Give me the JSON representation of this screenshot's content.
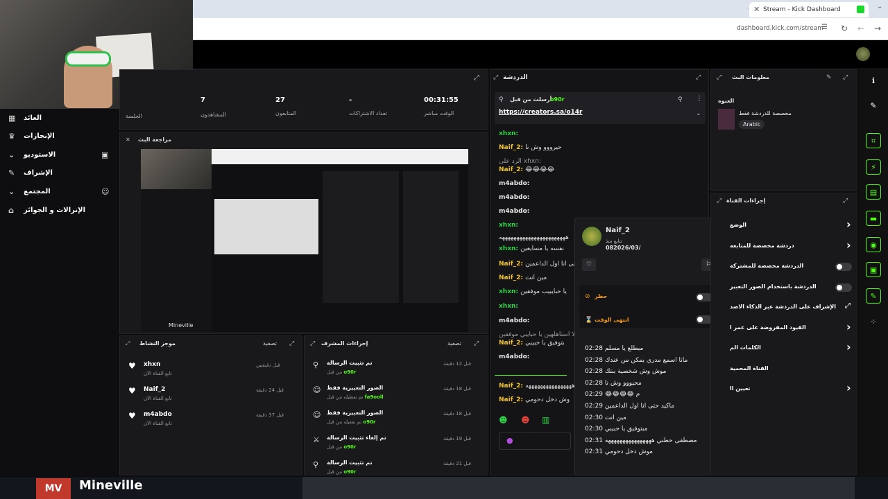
{
  "browser": {
    "tab_title": "Stream - Kick Dashboard",
    "tab_close": "✕",
    "new_tab": "+",
    "url": "dashboard.kick.com/stream"
  },
  "stats": [
    {
      "value": "00:31:55",
      "label": "الوقت مباشر"
    },
    {
      "value": "-",
      "label": "تعداد الاشتراكات"
    },
    {
      "value": "27",
      "label": "المتابعون"
    },
    {
      "value": "7",
      "label": "المشاهدون"
    },
    {
      "value": "",
      "label": "الجلسة"
    }
  ],
  "sidebar": [
    {
      "label": "العائد",
      "icon": "chart-icon"
    },
    {
      "label": "الإنجازات",
      "icon": "trophy-icon"
    },
    {
      "label": "الاستوديو",
      "icon": "chevron-down-icon"
    },
    {
      "label": "الإشراف",
      "icon": "wrench-icon"
    },
    {
      "label": "المجتمع",
      "icon": "chevron-down-icon"
    },
    {
      "label": "الإنزالات و الجوائز",
      "icon": "gift-icon"
    }
  ],
  "preview": {
    "title": "مراجعة البث",
    "caption": "Mineville"
  },
  "activity": {
    "title": "موجز النشاط",
    "filter": "تصفية",
    "items": [
      {
        "name": "xhxn",
        "sub": "تابع القناة الآن",
        "time": "قبل دقيقتين"
      },
      {
        "name": "Naif_2",
        "sub": "تابع القناة الآن",
        "time": "قبل 24 دقيقة"
      },
      {
        "name": "m4abdo",
        "sub": "تابع القناة الآن",
        "time": "قبل 37 دقيقة"
      }
    ]
  },
  "modactions": {
    "title": "إجراءات المشرف",
    "filter": "تصفية",
    "items": [
      {
        "action": "تم تثبيت الرسالة",
        "by": "o90r",
        "by_prefix": "من قبل",
        "time": "قبل 12 دقيقة"
      },
      {
        "action": "الصور التعبيرية فقط",
        "by": "fa9ooll",
        "by_prefix": "تم تعطيله من قبل",
        "time": "قبل 18 دقيقة"
      },
      {
        "action": "الصور التعبيرية فقط",
        "by": "o90r",
        "by_prefix": "تم تفعيله من قبل",
        "time": "قبل 18 دقيقة"
      },
      {
        "action": "تم إلغاء تثبيت الرسالة",
        "by": "o90r",
        "by_prefix": "من قبل",
        "time": "قبل 19 دقيقة"
      },
      {
        "action": "تم تثبيت الرسالة",
        "by": "o90r",
        "by_prefix": "من قبل",
        "time": "قبل 21 دقيقة"
      }
    ]
  },
  "chat": {
    "title": "الدردشة",
    "pinned_label": "أرسلت من قبل",
    "pinned_by": "o90r",
    "pinned_link": "https://creators.sa/o14r",
    "messages": [
      {
        "user": "xhxn",
        "text": "",
        "color": "#2fd34a"
      },
      {
        "user": "Naif_2",
        "text": "حيرووو وش نا",
        "color": "#f1c232"
      },
      {
        "user": "",
        "text": "الرد على xhxn:",
        "color": "#999"
      },
      {
        "user": "Naif_2",
        "text": "😂😂😂😂",
        "color": "#f1c232"
      },
      {
        "user": "m4abdo",
        "text": "",
        "color": "#e8e8e8"
      },
      {
        "user": "m4abdo",
        "text": "",
        "color": "#e8e8e8"
      },
      {
        "user": "m4abdo",
        "text": "",
        "color": "#e8e8e8"
      },
      {
        "user": "xhxn",
        "text": "",
        "color": "#2fd34a"
      },
      {
        "user": "",
        "text": "هههههههههههههههههههههههه",
        "color": "#ddd"
      },
      {
        "user": "xhxn",
        "text": "نفسه يا مسايعين",
        "color": "#2fd34a"
      },
      {
        "user": "Naif_2",
        "text": "حتى انا اول الداعمين",
        "color": "#f1c232"
      },
      {
        "user": "Naif_2",
        "text": "مين انت",
        "color": "#f1c232"
      },
      {
        "user": "xhxn",
        "text": "يا حبايبيب موفقين",
        "color": "#2fd34a"
      },
      {
        "user": "xhxn",
        "text": "",
        "color": "#2fd34a"
      },
      {
        "user": "m4abdo",
        "text": "",
        "color": "#e8e8e8"
      },
      {
        "user": "",
        "text": "لا استاهلهين يا حبايبي موفقين",
        "color": "#999"
      },
      {
        "user": "Naif_2",
        "text": "بتوفيق يا حبيبي",
        "color": "#f1c232"
      },
      {
        "user": "m4abdo",
        "text": "",
        "color": "#e8e8e8"
      },
      {
        "user": "Naif_2",
        "text": "ههههههههههههههههه",
        "color": "#f1c232"
      },
      {
        "user": "Naif_2",
        "text": "وش دخل دحومي",
        "color": "#f1c232"
      }
    ]
  },
  "usercard": {
    "name": "Naif_2",
    "follow_label": "تتابع منذ",
    "follow_date": "082026/03/",
    "ban_label": "حظر",
    "timeout_label": "انتهى الوقت",
    "history": [
      {
        "time": "02:28",
        "text": "مبطلع يا مسلم"
      },
      {
        "time": "02:28",
        "text": "مانا اسمع مدري يمكن من عندك"
      },
      {
        "time": "02:28",
        "text": "موش وش شخصية بنتك"
      },
      {
        "time": "02:28",
        "text": "محيووو وش نا"
      },
      {
        "time": "02:29",
        "text": "😂😂😂😂 م"
      },
      {
        "time": "02:29",
        "text": "ماكيد حتى انا اول الداعمين"
      },
      {
        "time": "02:30",
        "text": "مين انت"
      },
      {
        "time": "02:30",
        "text": "مبتوفيق يا حبيبي"
      },
      {
        "time": "02:31",
        "text": "مصطفى حطني ههههههههههههههههه"
      },
      {
        "time": "02:31",
        "text": "موش دخل دحومي"
      }
    ]
  },
  "streaminfo": {
    "title": "معلومات البث",
    "section": "العنوه",
    "desc": "مخصصة للدردشة فقط",
    "language": "Arabic"
  },
  "channelactions": {
    "title": "إجراءات القناة",
    "rows": [
      {
        "label": "الوضع",
        "control": "chevron"
      },
      {
        "label": "دردشة مخصصة للمتابعه",
        "control": "chevron"
      },
      {
        "label": "الدردشة مخصصة للمشتركة",
        "control": "toggle"
      },
      {
        "label": "الدردشة باستخدام الصور التعبير",
        "control": "toggle"
      },
      {
        "label": "الإشراف على الدردشة عبر الذكاء الاصد",
        "control": "external"
      },
      {
        "label": "القيود المفروضة على عمر ا",
        "control": "chevron"
      },
      {
        "label": "الكلمات الم",
        "control": "chevron"
      },
      {
        "label": "القناة المحمية",
        "control": "none"
      },
      {
        "label": "تعيين اا",
        "control": "chevron"
      }
    ]
  },
  "bottom_overlay": {
    "game_title": "Mineville",
    "game_logo": "MV"
  },
  "colors": {
    "kick_green": "#53fc18",
    "panel_bg": "#19191c",
    "page_bg": "#0b0b0d",
    "naif_color": "#f1c232",
    "xhxn_color": "#2fd34a"
  }
}
